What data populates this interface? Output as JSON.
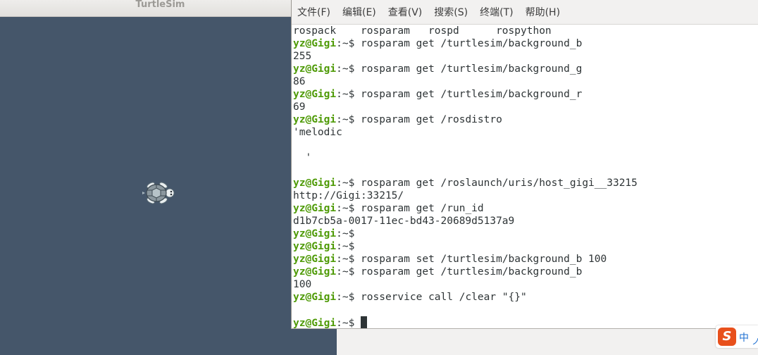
{
  "turtlesim": {
    "title": "TurtleSim",
    "background_color": "#45566a"
  },
  "terminal": {
    "menu": [
      "文件(F)",
      "编辑(E)",
      "查看(V)",
      "搜索(S)",
      "终端(T)",
      "帮助(H)"
    ],
    "prompt_user": "yz@Gigi",
    "prompt_path": ":~$",
    "lines": [
      {
        "type": "out",
        "text": "rospack    rosparam   rospd      rospython"
      },
      {
        "type": "cmd",
        "text": " rosparam get /turtlesim/background_b"
      },
      {
        "type": "out",
        "text": "255"
      },
      {
        "type": "cmd",
        "text": " rosparam get /turtlesim/background_g"
      },
      {
        "type": "out",
        "text": "86"
      },
      {
        "type": "cmd",
        "text": " rosparam get /turtlesim/background_r"
      },
      {
        "type": "out",
        "text": "69"
      },
      {
        "type": "cmd",
        "text": " rosparam get /rosdistro"
      },
      {
        "type": "out",
        "text": "'melodic"
      },
      {
        "type": "out",
        "text": ""
      },
      {
        "type": "out",
        "text": "  '"
      },
      {
        "type": "out",
        "text": ""
      },
      {
        "type": "cmd",
        "text": " rosparam get /roslaunch/uris/host_gigi__33215"
      },
      {
        "type": "out",
        "text": "http://Gigi:33215/"
      },
      {
        "type": "cmd",
        "text": " rosparam get /run_id"
      },
      {
        "type": "out",
        "text": "d1b7cb5a-0017-11ec-bd43-20689d5137a9"
      },
      {
        "type": "cmd",
        "text": ""
      },
      {
        "type": "cmd",
        "text": ""
      },
      {
        "type": "cmd",
        "text": " rosparam set /turtlesim/background_b 100"
      },
      {
        "type": "cmd",
        "text": " rosparam get /turtlesim/background_b"
      },
      {
        "type": "out",
        "text": "100"
      },
      {
        "type": "cmd",
        "text": " rosservice call /clear \"{}\""
      },
      {
        "type": "out",
        "text": ""
      },
      {
        "type": "cmd",
        "text": " ",
        "cursor": true
      }
    ],
    "colors": {
      "prompt_user": "#4e9a06",
      "text": "#2e3436"
    }
  },
  "ime": {
    "logo_letter": "S",
    "language": "中",
    "extra": "ノ",
    "brand_color": "#e8501c"
  }
}
